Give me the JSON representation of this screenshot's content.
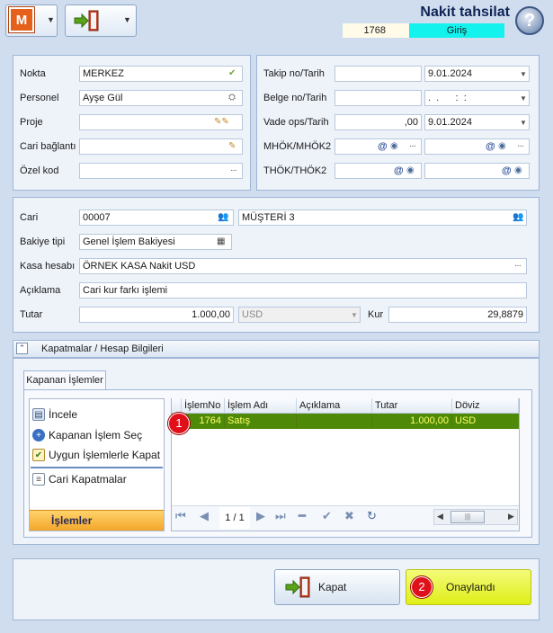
{
  "header": {
    "app_letter": "M",
    "title": "Nakit tahsilat",
    "doc_no": "1768",
    "status": "Giriş",
    "help": "?"
  },
  "left_panel": {
    "nokta_label": "Nokta",
    "nokta_value": "MERKEZ",
    "personel_label": "Personel",
    "personel_value": "Ayşe Gül",
    "proje_label": "Proje",
    "proje_value": "",
    "cari_baglanti_label": "Cari bağlantı",
    "cari_baglanti_value": "",
    "ozel_kod_label": "Özel kod",
    "ozel_kod_value": ""
  },
  "right_panel": {
    "takip_label": "Takip no/Tarih",
    "takip_no": "",
    "takip_tarih": "9.01.2024",
    "belge_label": "Belge no/Tarih",
    "belge_no": "",
    "belge_tarih": ".  .      :  :",
    "vade_label": "Vade ops/Tarih",
    "vade_ops": ",00",
    "vade_tarih": "9.01.2024",
    "mhok_label": "MHÖK/MHÖK2",
    "thok_label": "THÖK/THÖK2"
  },
  "main_panel": {
    "cari_label": "Cari",
    "cari_code": "00007",
    "cari_name": "MÜŞTERİ 3",
    "bakiye_label": "Bakiye tipi",
    "bakiye_value": "Genel İşlem Bakiyesi",
    "kasa_label": "Kasa hesabı",
    "kasa_value": "ÖRNEK KASA Nakit USD",
    "aciklama_label": "Açıklama",
    "aciklama_value": "Cari kur farkı işlemi",
    "tutar_label": "Tutar",
    "tutar_value": "1.000,00",
    "currency": "USD",
    "kur_label": "Kur",
    "kur_value": "29,8879"
  },
  "section": {
    "title": "Kapatmalar / Hesap Bilgileri",
    "tab": "Kapanan İşlemler"
  },
  "side_menu": {
    "incele": "İncele",
    "kapanan_sec": "Kapanan İşlem Seç",
    "uygun_kapat": "Uygun İşlemlerle Kapat",
    "cari_kapatmalar": "Cari Kapatmalar",
    "islemler": "İşlemler"
  },
  "grid": {
    "columns": [
      "İşlemNo",
      "İşlem Adı",
      "Açıklama",
      "Tutar",
      "Döviz"
    ],
    "rows": [
      {
        "islem_no": "1764",
        "islem_adi": "Satış",
        "aciklama": "",
        "tutar": "1.000,00",
        "doviz": "USD"
      }
    ],
    "pager": "1 / 1"
  },
  "badges": {
    "b1": "1",
    "b2": "2"
  },
  "footer": {
    "kapat": "Kapat",
    "onaylandi": "Onaylandı"
  },
  "colors": {
    "accent_row": "#4e8a08",
    "status_bg": "#14f2ee",
    "confirm_bg": "#e6f520",
    "badge": "#e0101a"
  }
}
